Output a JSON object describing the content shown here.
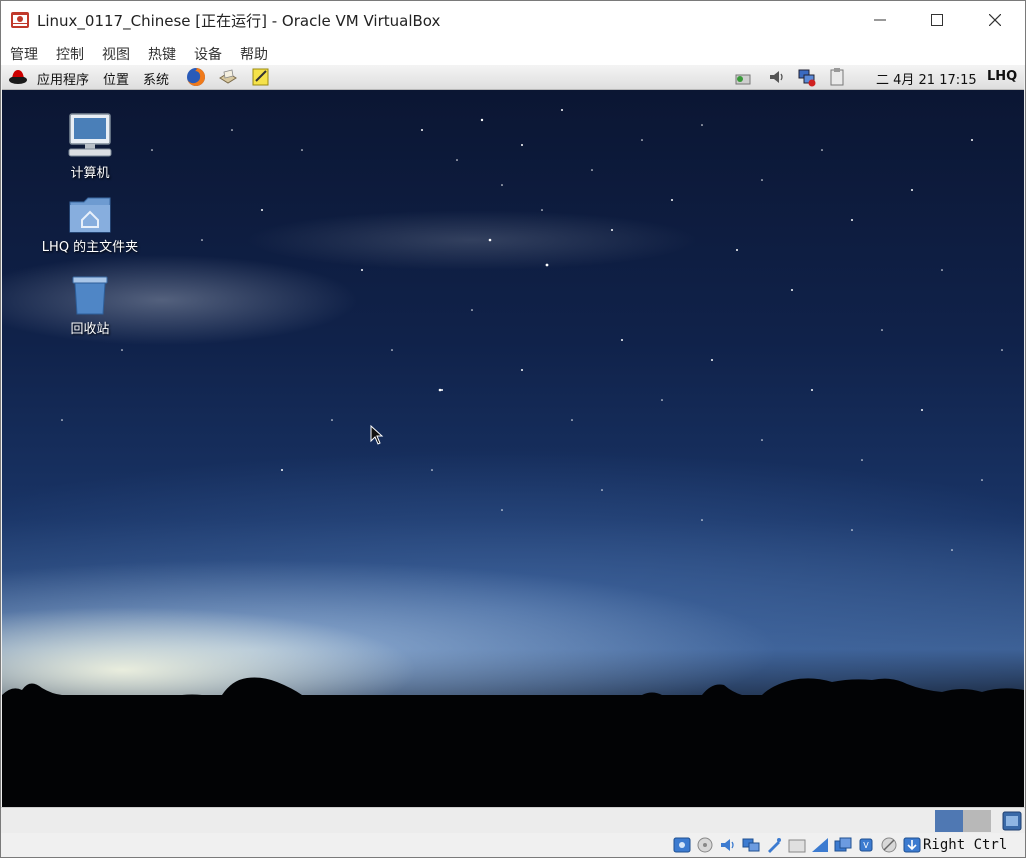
{
  "window": {
    "title": "Linux_0117_Chinese [正在运行] - Oracle VM VirtualBox",
    "controls": [
      "minimize",
      "maximize",
      "close"
    ]
  },
  "menubar": {
    "items": [
      "管理",
      "控制",
      "视图",
      "热键",
      "设备",
      "帮助"
    ]
  },
  "guest": {
    "panel": {
      "logo_icon": "redhat-icon",
      "menus": [
        "应用程序",
        "位置",
        "系统"
      ],
      "launchers": [
        "firefox-icon",
        "mail-icon",
        "notes-icon"
      ],
      "tray_icons": [
        "network-icon",
        "volume-icon",
        "network-disconnected-icon",
        "clipboard-icon"
      ],
      "clock": "二 4月 21 17:15",
      "user": "LHQ"
    },
    "desktop_icons": [
      {
        "label": "计算机",
        "icon": "computer-icon"
      },
      {
        "label": "LHQ 的主文件夹",
        "icon": "home-folder-icon"
      },
      {
        "label": "回收站",
        "icon": "trash-icon"
      }
    ]
  },
  "statusbar": {
    "icons": [
      "hard-disk-icon",
      "optical-drive-icon",
      "audio-icon",
      "network-icon",
      "usb-icon",
      "shared-folders-icon",
      "display-icon",
      "video-capture-icon",
      "cpu-icon",
      "mouse-integration-icon",
      "keyboard-capture-icon"
    ],
    "host_key": "Right Ctrl"
  },
  "colors": {
    "titlebar_bg": "#ffffff",
    "panel_bg": "#e8e8e8",
    "sky_top": "#0b1633",
    "horizon_glow": "#fffde6"
  }
}
